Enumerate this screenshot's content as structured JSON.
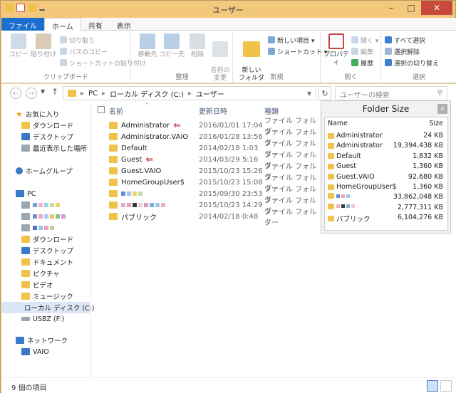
{
  "window": {
    "title": "ユーザー"
  },
  "tabs": [
    "ファイル",
    "ホーム",
    "共有",
    "表示"
  ],
  "ribbon": {
    "clipboard": {
      "copy": "コピー",
      "paste": "貼り付け",
      "cut": "切り取り",
      "copy_path": "パスのコピー",
      "paste_shortcut": "ショートカットの貼り付け",
      "label": "クリップボード"
    },
    "organize": {
      "move_to": "移動先",
      "copy_to": "コピー先",
      "delete": "削除",
      "rename": "名前の\n変更",
      "label": "整理"
    },
    "new": {
      "new_folder": "新しい\nフォルダー",
      "new_item": "新しい項目 ▾",
      "shortcut": "ショートカット ▾",
      "label": "新規"
    },
    "open": {
      "properties": "プロパティ",
      "open": "開く ▾",
      "edit": "編集",
      "history": "履歴",
      "label": "開く"
    },
    "select": {
      "select_all": "すべて選択",
      "select_none": "選択解除",
      "invert": "選択の切り替え",
      "label": "選択"
    }
  },
  "address": {
    "path": [
      "PC",
      "ローカル ディスク (C:)",
      "ユーザー"
    ],
    "search_placeholder": "ユーザーの検索"
  },
  "nav": {
    "favorites": "お気に入り",
    "downloads": "ダウンロード",
    "desktop": "デスクトップ",
    "recent": "最近表示した場所",
    "homegroup": "ホームグループ",
    "pc": "PC",
    "pc_downloads": "ダウンロード",
    "pc_desktop": "デスクトップ",
    "documents": "ドキュメント",
    "pictures": "ピクチャ",
    "videos": "ビデオ",
    "music": "ミュージック",
    "local_disk": "ローカル ディスク (C:)",
    "usb": "USBZ (F:)",
    "network": "ネットワーク",
    "vaio": "VAIO"
  },
  "columns": {
    "name": "名前",
    "date": "更新日時",
    "type": "種類"
  },
  "files": [
    {
      "name": "Administrator",
      "date": "2016/01/01 17:04",
      "type": "ファイル フォルダー",
      "arrow": true
    },
    {
      "name": "Administrator.VAIO",
      "date": "2016/01/28 13:56",
      "type": "ファイル フォルダー"
    },
    {
      "name": "Default",
      "date": "2014/02/18 1:03",
      "type": "ファイル フォルダー"
    },
    {
      "name": "Guest",
      "date": "2014/03/29 5:16",
      "type": "ファイル フォルダー",
      "arrow": true
    },
    {
      "name": "Guest.VAIO",
      "date": "2015/10/23 15:26",
      "type": "ファイル フォルダー"
    },
    {
      "name": "HomeGroupUser$",
      "date": "2015/10/23 15:08",
      "type": "ファイル フォルダー"
    },
    {
      "name": "",
      "date": "2015/09/30 23:53",
      "type": "ファイル フォルダー"
    },
    {
      "name": "",
      "date": "2015/10/23 14:29",
      "type": "ファイル フォルダー"
    },
    {
      "name": "パブリック",
      "date": "2014/02/18 0:48",
      "type": "ファイル フォルダー"
    }
  ],
  "folder_size": {
    "title": "Folder Size",
    "close": "x",
    "col_name": "Name",
    "col_size": "Size",
    "rows": [
      {
        "name": "Administrator",
        "size": "24 KB"
      },
      {
        "name": "Administrator",
        "size": "19,394,438 KB"
      },
      {
        "name": "Default",
        "size": "1,832 KB"
      },
      {
        "name": "Guest",
        "size": "1,360 KB"
      },
      {
        "name": "Guest.VAIO",
        "size": "92,680 KB"
      },
      {
        "name": "HomeGroupUser$",
        "size": "1,360 KB"
      },
      {
        "name": "",
        "size": "33,862,048 KB"
      },
      {
        "name": "",
        "size": "2,777,311 KB"
      },
      {
        "name": "パブリック",
        "size": "6,104,276 KB"
      }
    ]
  },
  "status": {
    "count": "9 個の項目"
  },
  "colors": {
    "file_tab": "#1c6fd0",
    "titlebar": "#f4c87c",
    "folder": "#f1c24a",
    "arrow": "#c9343a"
  }
}
